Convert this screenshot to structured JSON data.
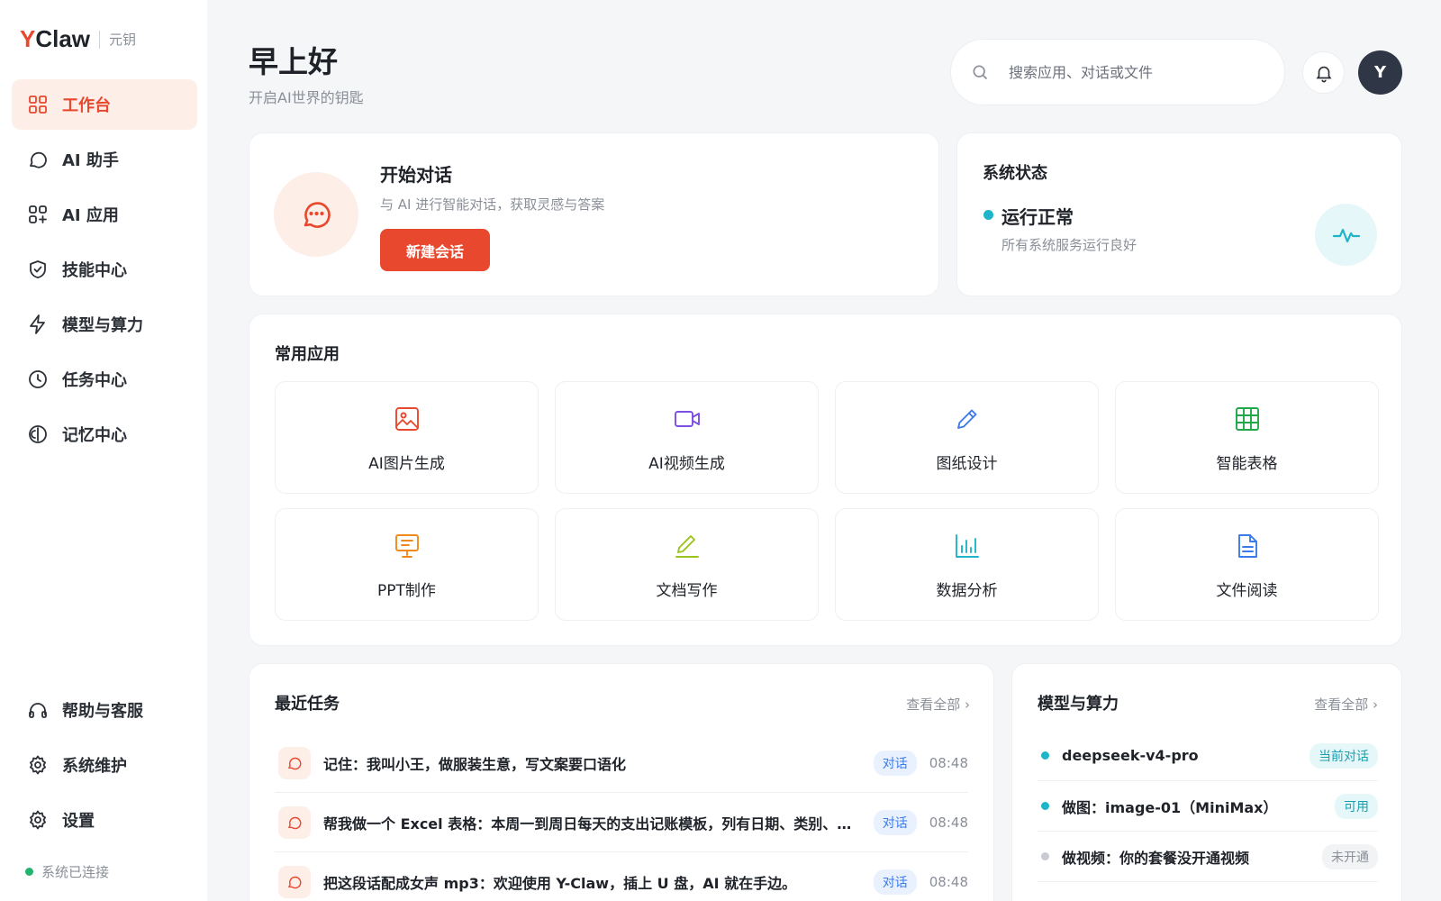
{
  "brand": {
    "logo_y": "Y",
    "logo_rest": "Claw",
    "subtitle": "元钥"
  },
  "nav": {
    "items": [
      {
        "label": "工作台",
        "icon": "grid-icon",
        "active": true
      },
      {
        "label": "AI 助手",
        "icon": "chat-bubble-icon"
      },
      {
        "label": "AI 应用",
        "icon": "apps-add-icon"
      },
      {
        "label": "技能中心",
        "icon": "shield-check-icon"
      },
      {
        "label": "模型与算力",
        "icon": "lightning-icon"
      },
      {
        "label": "任务中心",
        "icon": "clock-icon"
      },
      {
        "label": "记忆中心",
        "icon": "memory-icon"
      }
    ],
    "bottom": [
      {
        "label": "帮助与客服",
        "icon": "headset-icon"
      },
      {
        "label": "系统维护",
        "icon": "gear-icon"
      },
      {
        "label": "设置",
        "icon": "gear-icon"
      }
    ],
    "connection": "系统已连接"
  },
  "header": {
    "greeting": "早上好",
    "subtitle": "开启AI世界的钥匙",
    "search_placeholder": "搜索应用、对话或文件",
    "avatar": "Y"
  },
  "start": {
    "title": "开始对话",
    "desc": "与 AI 进行智能对话，获取灵感与答案",
    "button": "新建会话"
  },
  "status": {
    "title": "系统状态",
    "state": "运行正常",
    "desc": "所有系统服务运行良好"
  },
  "apps": {
    "title": "常用应用",
    "items": [
      {
        "label": "AI图片生成",
        "icon": "image-icon",
        "color": "#e8482e"
      },
      {
        "label": "AI视频生成",
        "icon": "video-icon",
        "color": "#7b4fe0"
      },
      {
        "label": "图纸设计",
        "icon": "pencil-icon",
        "color": "#3a7bea"
      },
      {
        "label": "智能表格",
        "icon": "table-icon",
        "color": "#22a84a"
      },
      {
        "label": "PPT制作",
        "icon": "presentation-icon",
        "color": "#f08a1c"
      },
      {
        "label": "文档写作",
        "icon": "pen-line-icon",
        "color": "#9cc41f"
      },
      {
        "label": "数据分析",
        "icon": "bar-chart-icon",
        "color": "#1fb5c8"
      },
      {
        "label": "文件阅读",
        "icon": "file-icon",
        "color": "#3a7bea"
      }
    ]
  },
  "tasks": {
    "title": "最近任务",
    "view_all": "查看全部 ›",
    "items": [
      {
        "text": "记住：我叫小王，做服装生意，写文案要口语化",
        "badge": "对话",
        "time": "08:48"
      },
      {
        "text": "帮我做一个 Excel 表格：本周一到周日每天的支出记账模板，列有日期、类别、金额、备注",
        "badge": "对话",
        "time": "08:48"
      },
      {
        "text": "把这段话配成女声 mp3：欢迎使用 Y-Claw，插上 U 盘，AI 就在手边。",
        "badge": "对话",
        "time": "08:48"
      }
    ]
  },
  "models": {
    "title": "模型与算力",
    "view_all": "查看全部 ›",
    "items": [
      {
        "name": "deepseek-v4-pro",
        "badge": "当前对话",
        "dot": "#1fb5c8",
        "badge_bg": "#e6f7f9",
        "badge_fg": "#1a9fb0"
      },
      {
        "name": "做图：image-01（MiniMax）",
        "badge": "可用",
        "dot": "#1fb5c8",
        "badge_bg": "#e6f7f9",
        "badge_fg": "#1a9fb0"
      },
      {
        "name": "做视频：你的套餐没开通视频",
        "badge": "未开通",
        "dot": "#c8ccd2",
        "badge_bg": "#f2f3f5",
        "badge_fg": "#8a8f98"
      }
    ]
  },
  "colors": {
    "accent": "#e8482e",
    "teal": "#1fb5c8",
    "online": "#22b46e"
  }
}
